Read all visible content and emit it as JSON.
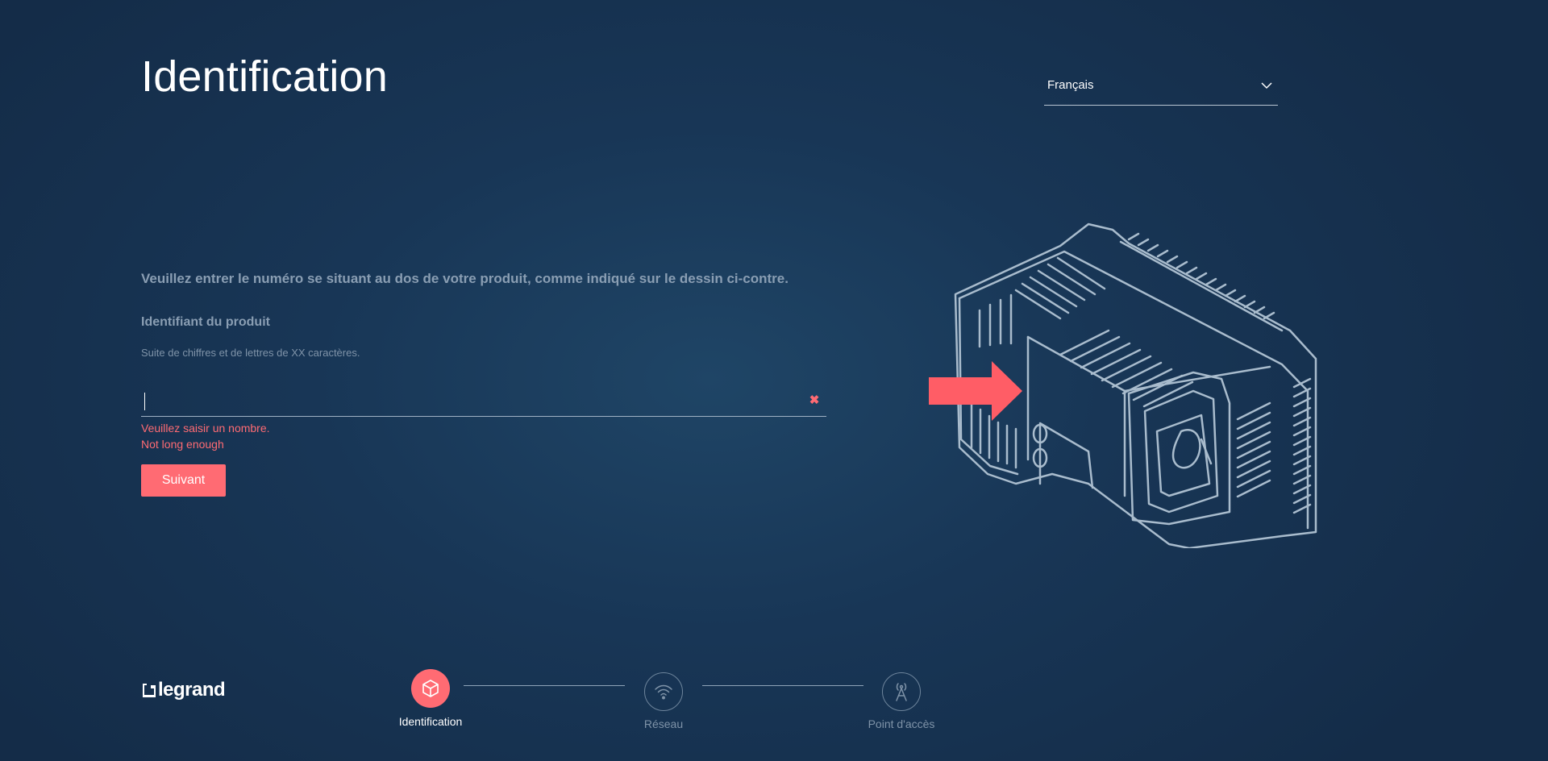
{
  "page": {
    "title": "Identification"
  },
  "language": {
    "selected": "Français",
    "icon": "chevron-down-icon"
  },
  "form": {
    "instruction": "Veuillez entrer le numéro se situant au dos de votre produit, comme indiqué sur le dessin ci-contre.",
    "field_label": "Identifiant du produit",
    "field_hint": "Suite de chiffres et de lettres de XX caractères.",
    "input_value": "",
    "clear_icon": "close-icon",
    "clear_glyph": "✖",
    "errors": [
      "Veuillez saisir un nombre.",
      "Not long enough"
    ],
    "next_label": "Suivant"
  },
  "brand": {
    "logo_text": "legrand"
  },
  "steps": [
    {
      "label": "Identification",
      "icon": "cube-icon",
      "state": "active"
    },
    {
      "label": "Réseau",
      "icon": "wifi-icon",
      "state": "inactive"
    },
    {
      "label": "Point d'accès",
      "icon": "antenna-icon",
      "state": "inactive"
    }
  ],
  "colors": {
    "accent": "#ff6b73",
    "background": "#183656",
    "muted_text": "#8a9eb3",
    "illustration_stroke": "#a9bccd"
  }
}
